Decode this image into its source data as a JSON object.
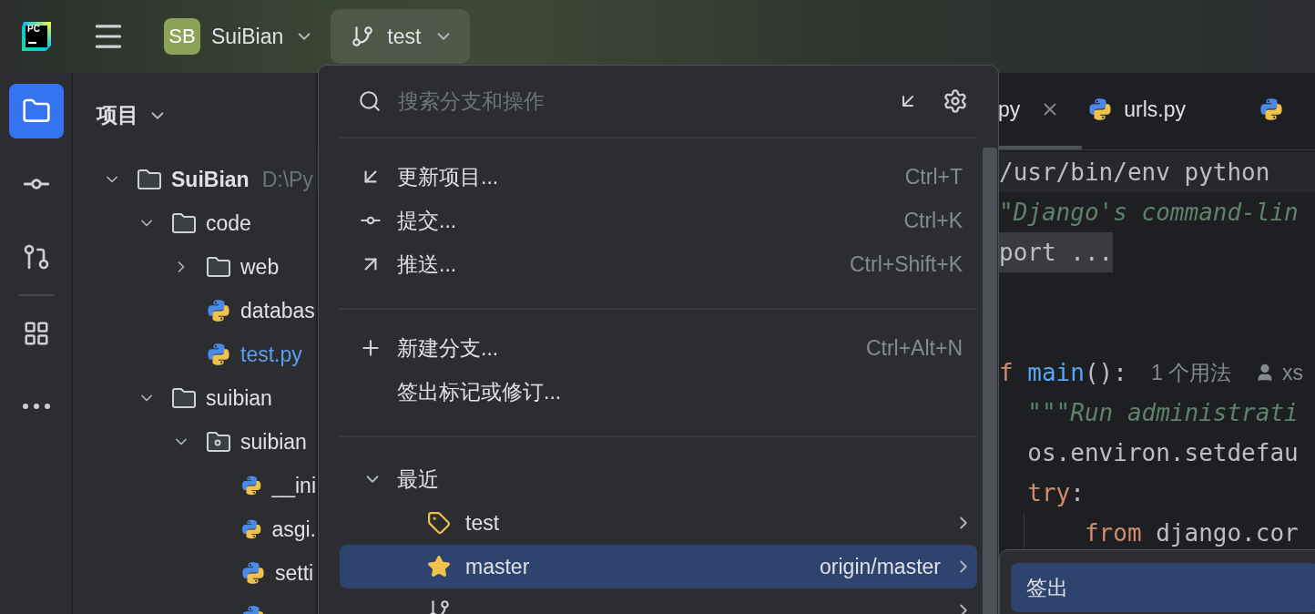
{
  "top_bar": {
    "logo": "PC",
    "project": {
      "initials": "SB",
      "name": "SuiBian"
    },
    "branch": "test"
  },
  "tool_strip": [
    {
      "kind": "project",
      "selected": true
    },
    {
      "kind": "commit",
      "selected": false
    },
    {
      "kind": "pull_requests",
      "selected": false
    },
    {
      "kind": "structure",
      "selected": false
    },
    {
      "kind": "more",
      "selected": false
    }
  ],
  "project_panel": {
    "title": "项目",
    "tree": [
      {
        "kind": "folder",
        "name": "SuiBian",
        "path": "D:\\Py",
        "expanded": true,
        "children": [
          {
            "kind": "folder",
            "name": "code",
            "expanded": true,
            "children": [
              {
                "kind": "folder",
                "name": "web",
                "expanded": false
              },
              {
                "kind": "python",
                "name": "databas",
                "changed": false
              },
              {
                "kind": "python",
                "name": "test.py",
                "changed": true
              }
            ]
          },
          {
            "kind": "folder",
            "name": "suibian",
            "expanded": true,
            "children": [
              {
                "kind": "package",
                "name": "suibian",
                "expanded": true,
                "children": [
                  {
                    "kind": "python",
                    "name": "__ini",
                    "changed": false
                  },
                  {
                    "kind": "python",
                    "name": "asgi.",
                    "changed": false
                  },
                  {
                    "kind": "python",
                    "name": "setti",
                    "changed": false
                  },
                  {
                    "kind": "python"
                  }
                ]
              }
            ]
          }
        ]
      }
    ]
  },
  "editor": {
    "tabs": [
      {
        "label": "py",
        "selected": true,
        "closable": true
      },
      {
        "label": "urls.py",
        "selected": false,
        "closable": false
      },
      {
        "selected": false,
        "closable": false
      }
    ],
    "lines": [
      {
        "kind": "code",
        "current": true,
        "tokens": [
          {
            "text": "/usr/bin/env python",
            "kind": "plain"
          }
        ]
      },
      {
        "kind": "code",
        "current": false,
        "tokens": [
          {
            "text": "\"Django's command-lin",
            "kind": "docstring"
          }
        ]
      },
      {
        "kind": "code",
        "current": false,
        "tokens": [
          {
            "text": "port ...",
            "kind": "folded"
          }
        ]
      },
      {
        "kind": "blank"
      },
      {
        "kind": "blank"
      },
      {
        "kind": "code",
        "current": false,
        "tokens": [
          {
            "text": "f ",
            "kind": "keyword"
          },
          {
            "text": "main",
            "kind": "function"
          },
          {
            "text": "():",
            "kind": "plain"
          }
        ],
        "hint": {
          "usages": "1 个用法",
          "author": "xs"
        }
      },
      {
        "kind": "code",
        "current": false,
        "tokens": [
          {
            "text": "  \"\"\"Run administrati",
            "kind": "docstring"
          }
        ]
      },
      {
        "kind": "code",
        "current": false,
        "tokens": [
          {
            "text": "  os.environ.setdefau",
            "kind": "plain"
          }
        ]
      },
      {
        "kind": "code",
        "current": false,
        "tokens": [
          {
            "text": "  try",
            "kind": "keyword"
          },
          {
            "text": ":",
            "kind": "plain"
          }
        ]
      },
      {
        "kind": "code",
        "current": false,
        "guide": true,
        "tokens": [
          {
            "text": "      from",
            "kind": "keyword"
          },
          {
            "text": " django.cor",
            "kind": "plain"
          }
        ]
      }
    ]
  },
  "popup": {
    "search_placeholder": "搜索分支和操作",
    "groups": [
      {
        "items": [
          {
            "kind": "update",
            "label": "更新项目...",
            "shortcut": "Ctrl+T"
          },
          {
            "kind": "commit",
            "label": "提交...",
            "shortcut": "Ctrl+K"
          },
          {
            "kind": "push",
            "label": "推送...",
            "shortcut": "Ctrl+Shift+K"
          }
        ]
      },
      {
        "items": [
          {
            "kind": "new_branch",
            "label": "新建分支...",
            "shortcut": "Ctrl+Alt+N"
          },
          {
            "kind": "checkout",
            "label": "签出标记或修订..."
          }
        ]
      }
    ],
    "recent": {
      "title": "最近",
      "expanded": true,
      "items": [
        {
          "kind": "tag",
          "name": "test",
          "selected": false
        },
        {
          "kind": "favorite",
          "name": "master",
          "remote": "origin/master",
          "selected": true
        },
        {
          "kind": "branch",
          "selected": false
        }
      ]
    }
  },
  "submenu": {
    "items": [
      {
        "label": "签出",
        "selected": true
      }
    ]
  }
}
